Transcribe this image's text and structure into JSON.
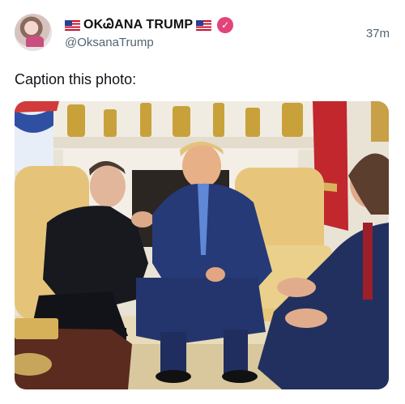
{
  "post": {
    "display_name": "OKᏊANA TRUMP",
    "handle": "@OksanaTrump",
    "time_ago": "37m",
    "text": "Caption this photo:"
  },
  "icons": {
    "left_flag": "us-flag-icon",
    "right_flag": "us-flag-icon",
    "verified": "verified-badge-icon"
  },
  "colors": {
    "verified_badge": "#e2447a",
    "handle_text": "#536471"
  }
}
